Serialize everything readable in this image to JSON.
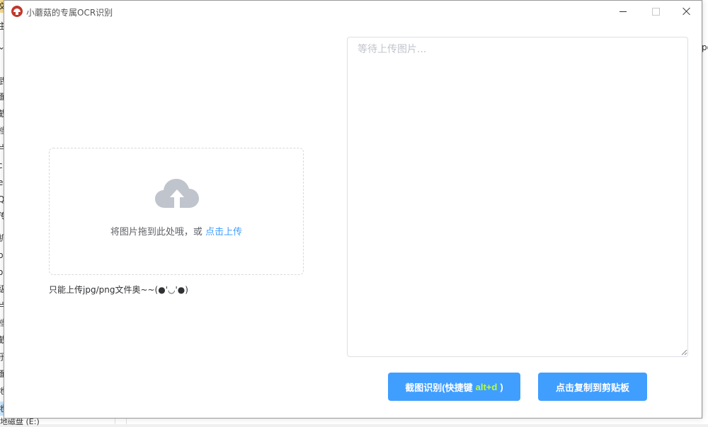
{
  "window": {
    "title": "小蘑菇的专属OCR识别",
    "controls": [
      "minimize",
      "maximize",
      "close"
    ]
  },
  "upload": {
    "text": "将图片拖到此处哦，或 ",
    "link": "点击上传",
    "tip": "只能上传jpg/png文件奥~~(●'◡'●)",
    "icon": "cloud-upload-icon"
  },
  "result": {
    "placeholder": "等待上传图片..."
  },
  "buttons": {
    "ocr_prefix": "截图识别(快捷键",
    "ocr_hotkey": "alt+d",
    "ocr_suffix": ")",
    "copy_label": "点击复制到剪贴板"
  },
  "background": {
    "left_fragments": [
      "文",
      "主",
      "⌄",
      "武",
      "面",
      "截",
      "档",
      "片",
      "c",
      "el",
      "Q",
      "传",
      "机",
      "po",
      "o",
      "级",
      "片",
      "档",
      "截",
      "乐",
      "面",
      "地",
      "地"
    ],
    "bottom_fragment": "地磁盘 (E:)",
    "right_fragment": "pg"
  },
  "colors": {
    "primary": "#409eff",
    "hotkey": "#b8ff3a",
    "app_icon": "#c0392b"
  }
}
